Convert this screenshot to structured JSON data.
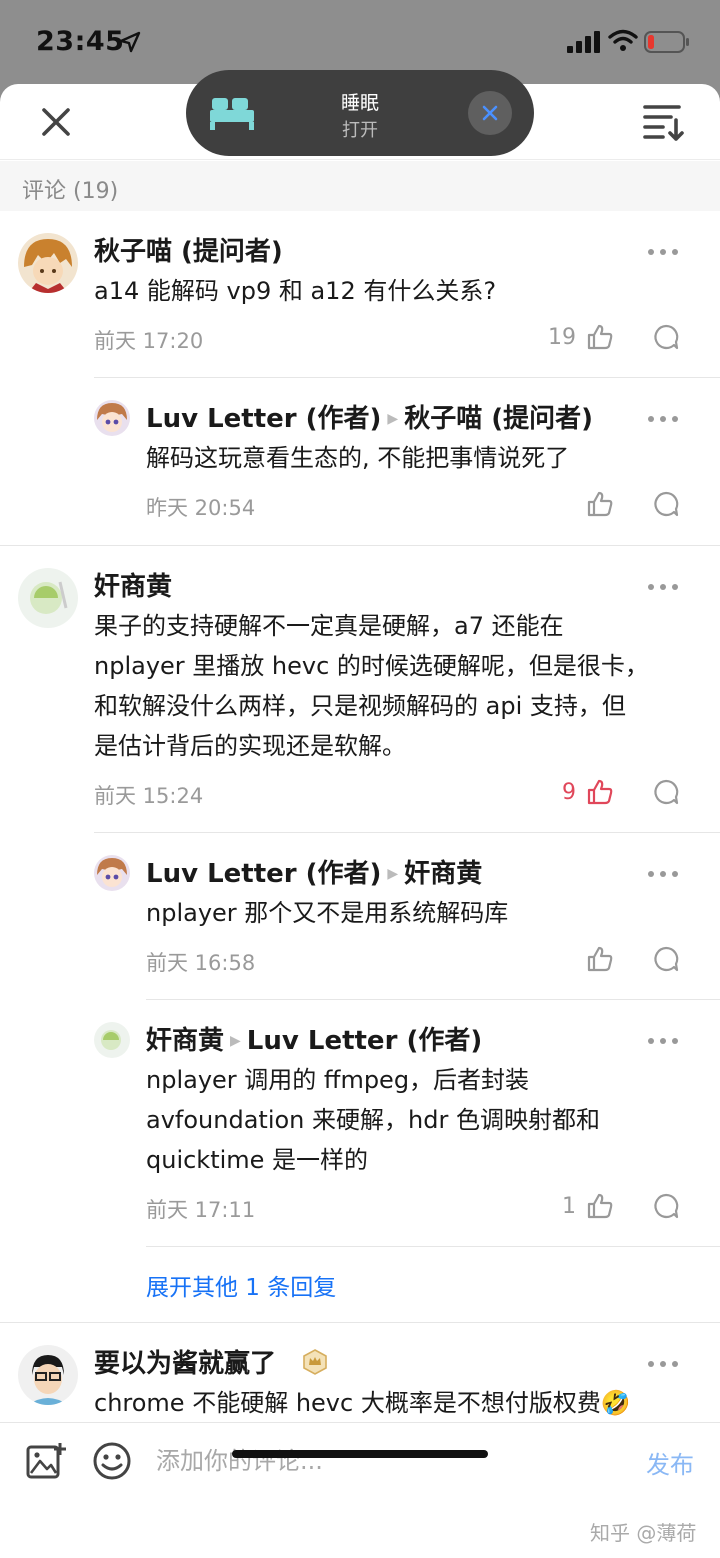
{
  "status": {
    "time": "23:45"
  },
  "sleep_banner": {
    "title": "睡眠",
    "subtitle": "打开"
  },
  "comments_header": {
    "count_label": "评论 (19)"
  },
  "comments": [
    {
      "name": "秋子喵 (提问者)",
      "text": "a14 能解码 vp9 和 a12 有什么关系?",
      "time": "前天 17:20",
      "likes": "19"
    },
    {
      "name": "Luv Letter (作者)",
      "reply_to": "秋子喵 (提问者)",
      "text": "解码这玩意看生态的, 不能把事情说死了",
      "time": "昨天 20:54",
      "likes": ""
    },
    {
      "name": "奸商黄",
      "text_lines": [
        "果子的支持硬解不一定真是硬解，a7 还能在",
        "nplayer 里播放 hevc 的时候选硬解呢，但是很卡，",
        "和软解没什么两样，只是视频解码的 api 支持，但",
        "是估计背后的实现还是软解。"
      ],
      "time": "前天 15:24",
      "likes": "9"
    },
    {
      "name": "Luv Letter (作者)",
      "reply_to": "奸商黄",
      "text": "nplayer 那个又不是用系统解码库",
      "time": "前天 16:58",
      "likes": ""
    },
    {
      "name": "奸商黄",
      "reply_to": "Luv Letter (作者)",
      "text_lines": [
        "nplayer 调用的 ffmpeg，后者封装",
        "avfoundation 来硬解，hdr 色调映射都和",
        "quicktime 是一样的"
      ],
      "time": "前天 17:11",
      "likes": "1"
    },
    {
      "name": "要以为酱就赢了",
      "text": "chrome 不能硬解 hevc 大概率是不想付版权费🤣"
    }
  ],
  "expand_more": "展开其他 1 条回复",
  "composer": {
    "placeholder": "添加你的评论...",
    "publish": "发布"
  },
  "watermark": "知乎 @薄荷",
  "colors": {
    "liked": "#e0475a",
    "link": "#1772f6",
    "publish": "#8ab8f5"
  }
}
